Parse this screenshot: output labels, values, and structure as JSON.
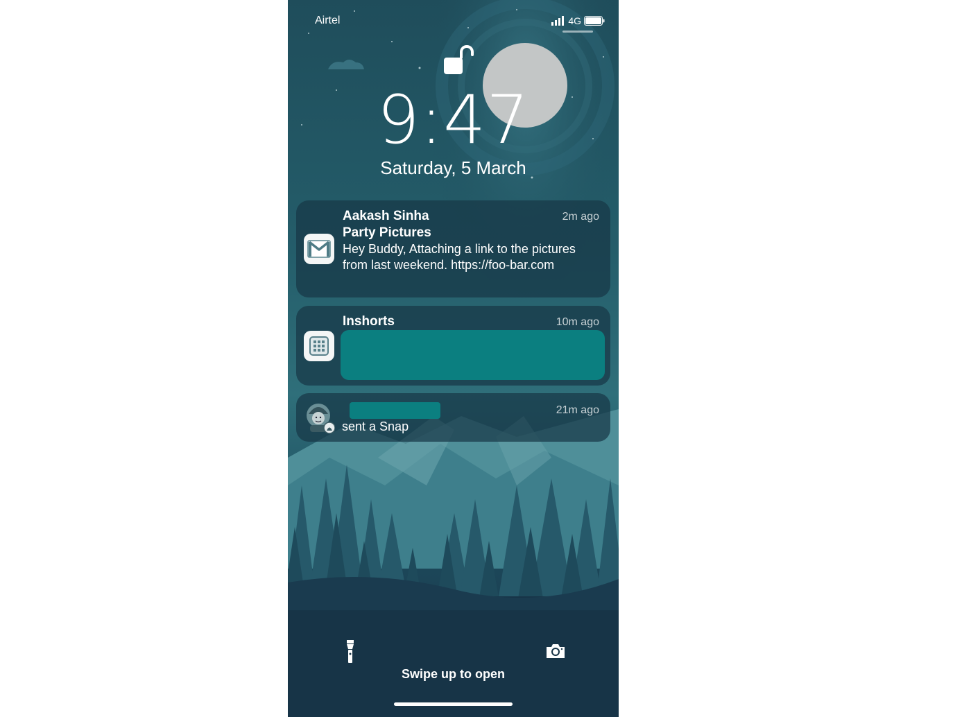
{
  "status_bar": {
    "carrier": "Airtel",
    "network": "4G"
  },
  "lock_screen": {
    "time": "9:47",
    "date": "Saturday, 5 March"
  },
  "notifications": [
    {
      "app_icon": "gmail-icon",
      "sender": "Aakash Sinha",
      "subject": "Party Pictures",
      "body": "Hey Buddy, Attaching a link to the pictures from last weekend. https://foo-bar.com",
      "time": "2m ago"
    },
    {
      "app_icon": "inshorts-icon",
      "title": "Inshorts",
      "time": "10m ago"
    },
    {
      "app_icon": "snapchat-bitmoji-icon",
      "message": "sent a Snap",
      "time": "21m ago"
    }
  ],
  "bottom": {
    "swipe_text": "Swipe up to open"
  },
  "colors": {
    "redaction": "#0b7f80",
    "notification_bg": "#173846"
  }
}
